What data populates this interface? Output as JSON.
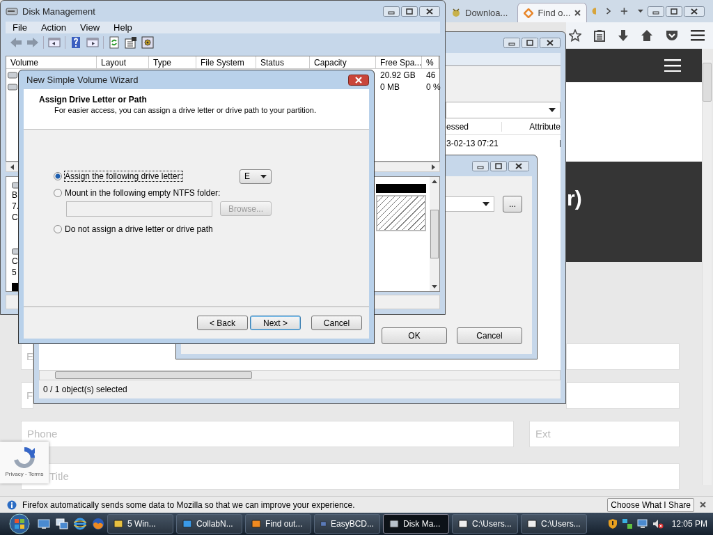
{
  "browser": {
    "tabs": [
      {
        "label": "Downloa...",
        "selected": false
      },
      {
        "label": "Find o...",
        "selected": true
      }
    ],
    "page": {
      "heading": "r)",
      "fields": [
        {
          "placeholder": "E"
        },
        {
          "placeholder": "F"
        },
        {
          "placeholder": "Phone"
        },
        {
          "placeholder": "Ext"
        },
        {
          "placeholder": "Title"
        }
      ]
    },
    "recaptcha": {
      "links": "Privacy - Terms"
    },
    "notification": {
      "message": "Firefox automatically sends some data to Mozilla so that we can improve your experience.",
      "button": "Choose What I Share"
    }
  },
  "explorer_window": {
    "columns": [
      "essed",
      "Attribute"
    ],
    "row": [
      "3-02-13 07:21"
    ],
    "status": "0 / 1 object(s) selected"
  },
  "options_dialog": {
    "browse_button": "...",
    "buttons": [
      "OK",
      "Cancel"
    ]
  },
  "disk_management": {
    "title": "Disk Management",
    "menu": [
      "File",
      "Action",
      "View",
      "Help"
    ],
    "columns": [
      "Volume",
      "Layout",
      "Type",
      "File System",
      "Status",
      "Capacity",
      "Free Spa...",
      "%"
    ],
    "rows": [
      [
        "20.92 GB",
        "46"
      ],
      [
        "0 MB",
        "0 %"
      ]
    ],
    "disks": [
      [
        "B",
        "7.",
        "C"
      ],
      [
        "C",
        "5"
      ]
    ]
  },
  "wizard": {
    "title": "New Simple Volume Wizard",
    "heading": "Assign Drive Letter or Path",
    "subtitle": "For easier access, you can assign a drive letter or drive path to your partition.",
    "options": [
      {
        "label": "Assign the following drive letter:",
        "selected": true,
        "kind": "letter",
        "value": "E"
      },
      {
        "label": "Mount in the following empty NTFS folder:",
        "selected": false,
        "kind": "folder",
        "button": "Browse...",
        "disabled": true
      },
      {
        "label": "Do not assign a drive letter or drive path",
        "selected": false,
        "kind": "none"
      }
    ],
    "buttons": [
      "< Back",
      "Next >",
      "Cancel"
    ]
  },
  "taskbar": {
    "items": [
      {
        "label": "5 Win...",
        "selected": false
      },
      {
        "label": "CollabN...",
        "selected": false
      },
      {
        "label": "Find out...",
        "selected": false
      },
      {
        "label": "EasyBCD...",
        "selected": false
      },
      {
        "label": "Disk Ma...",
        "selected": true
      },
      {
        "label": "C:\\Users...",
        "selected": false
      },
      {
        "label": "C:\\Users...",
        "selected": false
      }
    ],
    "clock": "12:05 PM"
  }
}
